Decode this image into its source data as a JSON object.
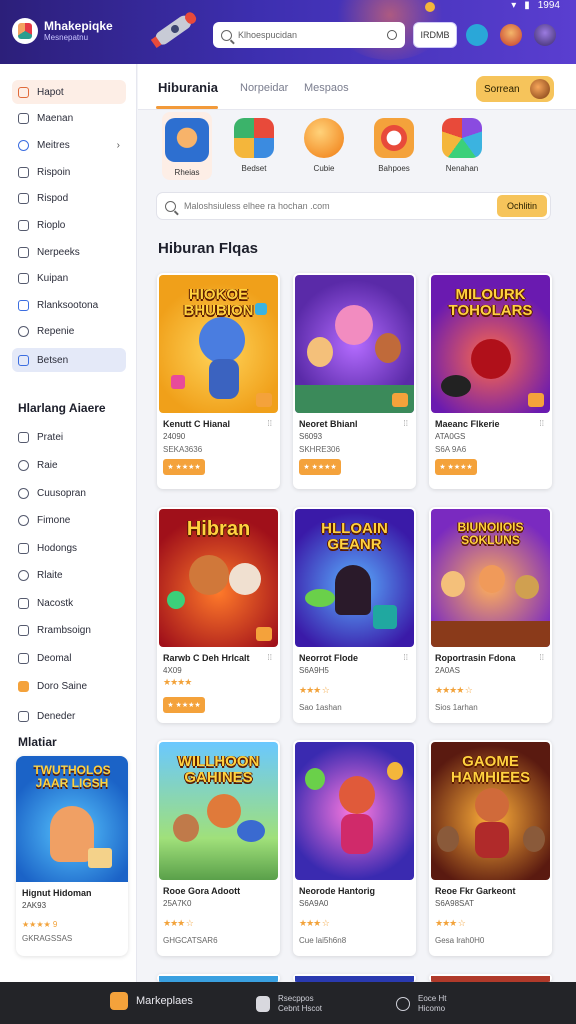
{
  "header": {
    "brand_title": "Mhakepiqke",
    "brand_subtitle": "Mesnepatnu",
    "search_placeholder": "Klhoespucidan",
    "button_label": "IRDMB",
    "status_time": "1994"
  },
  "sidebar": {
    "items": [
      {
        "label": "Hapot"
      },
      {
        "label": "Maenan"
      },
      {
        "label": "Meitres"
      },
      {
        "label": "Rispoin"
      },
      {
        "label": "Rispod"
      },
      {
        "label": "Rioplo"
      },
      {
        "label": "Nerpeeks"
      },
      {
        "label": "Kuipan"
      },
      {
        "label": "Rlanksootona"
      },
      {
        "label": "Repenie"
      },
      {
        "label": "Betsen"
      }
    ],
    "section2_title": "Hlarlang Aiaere",
    "items2": [
      {
        "label": "Pratei"
      },
      {
        "label": "Raie"
      },
      {
        "label": "Cuusopran"
      },
      {
        "label": "Fimone"
      },
      {
        "label": "Hodongs"
      },
      {
        "label": "Rlaite"
      },
      {
        "label": "Nacostk"
      },
      {
        "label": "Rrambsoign"
      },
      {
        "label": "Deomal"
      },
      {
        "label": "Doro Saine"
      },
      {
        "label": "Deneder"
      }
    ],
    "section3_title": "Mlatiar",
    "promo": {
      "art_title": "TWUTHOLOS JAAR LIGSH",
      "name": "Hignut Hidoman",
      "price": "2AK93",
      "rating_text": "★★★★ 9",
      "meta": "GKRAGSSAS"
    }
  },
  "main": {
    "tabs": [
      {
        "label": "Hiburania"
      },
      {
        "label": "Norpeidar"
      },
      {
        "label": "Mespaos"
      }
    ],
    "action_button": "Sorrean",
    "categories": [
      {
        "label": "Rheias"
      },
      {
        "label": "Bedset"
      },
      {
        "label": "Cubie"
      },
      {
        "label": "Bahpoes"
      },
      {
        "label": "Nenahan"
      }
    ],
    "search_placeholder": "Maloshsiuless elhee ra hochan .com",
    "search_button": "Ochlitin",
    "section_title": "Hiburan Flqas",
    "cards": [
      {
        "art_title": "HIOKOE BHUBION",
        "name": "Kenutt C Hianal",
        "line1": "24090",
        "line2": "SEKA3636",
        "cta": "★ ★★★★"
      },
      {
        "art_title": "",
        "name": "Neoret Bhianl",
        "line1": "S6093",
        "line2": "SKHRE306",
        "cta": "★ ★★★★"
      },
      {
        "art_title": "MILOURK TOHOLARS",
        "name": "Maeanc Flkerie",
        "line1": "ATA0GS",
        "line2": "S6A 9A6",
        "cta": "★ ★★★★"
      },
      {
        "art_title": "Hibran",
        "name": "Rarwb C Deh Hrlcalt",
        "line1": "4X09",
        "line2": "",
        "stars": "★★★★",
        "cta": "★ ★★★★"
      },
      {
        "art_title": "HLLOAIN GEANR",
        "name": "Neorrot Flode",
        "line1": "S6A9H5",
        "stars": "★★★ ☆",
        "line2": "Sao 1ashan"
      },
      {
        "art_title": "BIUNOIIOIS SOKLUNS",
        "name": "Roportrasin Fdona",
        "line1": "2A0AS",
        "stars": "★★★★ ☆",
        "line2": "Sios 1arhan"
      },
      {
        "art_title": "WILLHOON GAHINES",
        "name": "Rooe Gora Adoott",
        "line1": "25A7K0",
        "stars": "★★★ ☆",
        "line2": "GHGCATSAR6"
      },
      {
        "art_title": "",
        "name": "Neorode Hantorig",
        "line1": "S6A9A0",
        "stars": "★★★ ☆",
        "line2": "Cue lai5h6n8"
      },
      {
        "art_title": "GAOME HAMHIEES",
        "name": "Reoe Fkr Garkeont",
        "line1": "S6A98SAT",
        "stars": "★★★ ☆",
        "line2": "Gesa lrah0H0"
      }
    ]
  },
  "bottom_bar": {
    "item1": "Markeplaes",
    "item2_line1": "Rsecppos",
    "item2_line2": "Cebnt Hscot",
    "item3_line1": "Eoce Ht",
    "item3_line2": "Hicomo"
  }
}
